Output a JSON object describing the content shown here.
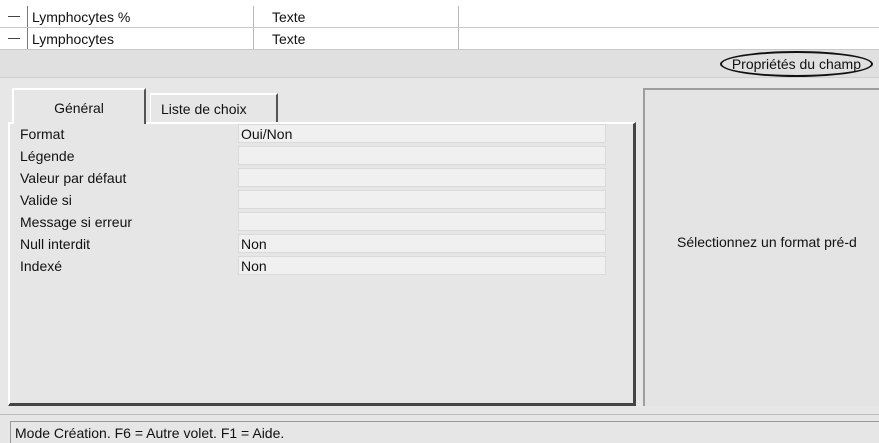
{
  "fields_table": {
    "rows": [
      {
        "name": "Lymphocytes %",
        "type": "Texte"
      },
      {
        "name": "Lymphocytes",
        "type": "Texte"
      }
    ]
  },
  "properties_header": {
    "title": "Propriétés du champ"
  },
  "tabs": [
    {
      "label": "Général",
      "active": true
    },
    {
      "label": "Liste de choix",
      "active": false
    }
  ],
  "properties": [
    {
      "label": "Format",
      "value": "Oui/Non"
    },
    {
      "label": "Légende",
      "value": ""
    },
    {
      "label": "Valeur par défaut",
      "value": ""
    },
    {
      "label": "Valide si",
      "value": ""
    },
    {
      "label": "Message si erreur",
      "value": ""
    },
    {
      "label": "Null interdit",
      "value": "Non"
    },
    {
      "label": "Indexé",
      "value": "Non"
    }
  ],
  "help_pane": {
    "text": "Sélectionnez un format pré-d"
  },
  "status_bar": {
    "text": "Mode Création. F6 = Autre volet. F1 = Aide."
  },
  "colors": {
    "background": "#e7e7e7",
    "grid_background": "#ffffff",
    "value_field": "#f0f0f0",
    "dark_border": "#444444"
  }
}
